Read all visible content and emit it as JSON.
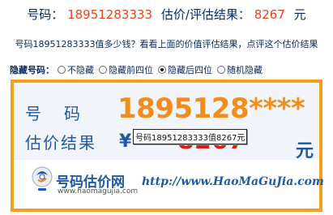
{
  "headline": {
    "number_label": "号码：",
    "number_value": "18951283333",
    "result_label": "估价/评估结果：",
    "result_value": "8267",
    "unit": "元"
  },
  "question_text": "号码18951283333值多少钱？看看上面的价值评估结果，点评这个估价结果",
  "hide_options": {
    "label": "隐藏号码：",
    "options": [
      "不隐藏",
      "隐藏前四位",
      "隐藏后四位",
      "随机隐藏"
    ],
    "selected": "隐藏后四位"
  },
  "card": {
    "number_label": "号码",
    "masked_number": "1895128****",
    "result_label": "估价结果",
    "currency_symbol": "¥",
    "price": "8267",
    "unit": "元",
    "tooltip": "号码18951283333值8267元"
  },
  "branding": {
    "logo_name": "号码估价网",
    "logo_url": "www.haomagujia.com",
    "site_url": "http://www.HaoMaGuJia.com"
  },
  "colors": {
    "accent_orange": "#f28c1a",
    "headline_red": "#e8441a",
    "price_red": "#e81818",
    "brand_blue": "#1f5aa6",
    "border_orange": "#f2a020"
  }
}
